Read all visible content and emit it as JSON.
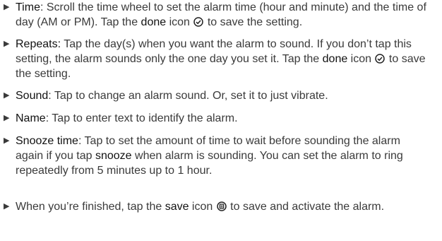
{
  "items": [
    {
      "term": "Time",
      "sep": ": ",
      "text1": "Scroll the time wheel to set the alarm time (hour and minute) and the time of day (AM or PM). Tap the ",
      "kw1": "done",
      "text2": " icon ",
      "icon": "checkmark-circle-icon",
      "text3": " to save the setting."
    },
    {
      "term": "Repeats:",
      "sep": " ",
      "text1": "Tap the day(s) when you want the alarm to sound. If you don’t tap this setting, the alarm sounds only the one day you set it. Tap the ",
      "kw1": "done",
      "text2": " icon ",
      "icon": "checkmark-circle-icon",
      "text3": " to save the setting."
    },
    {
      "term": "Sound",
      "sep": ": ",
      "text1": "Tap to change an alarm sound. Or, set it to just vibrate."
    },
    {
      "term": "Name",
      "sep": ": ",
      "text1": "Tap to enter text to identify the alarm."
    },
    {
      "term": "Snooze time",
      "sep": ": ",
      "text1": "Tap to set the amount of time to wait before sounding the alarm again if you tap ",
      "kw1": "snooze",
      "text2": " when alarm is sounding. You can set the alarm to ring repeatedly from 5 minutes up to 1 hour."
    },
    {
      "text1": "When you’re finished, tap the ",
      "kw1": "save",
      "text2": " icon ",
      "icon": "save-circle-icon",
      "text3": " to save and activate the alarm."
    }
  ]
}
